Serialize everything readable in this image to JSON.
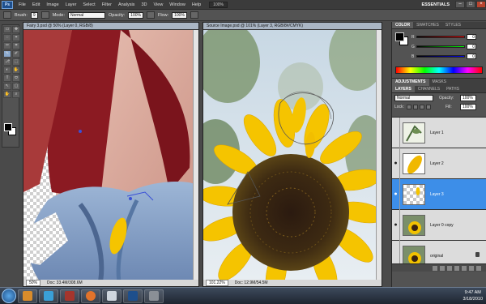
{
  "menubar": {
    "app": "Ps",
    "items": [
      "File",
      "Edit",
      "Image",
      "Layer",
      "Select",
      "Filter",
      "Analysis",
      "3D",
      "View",
      "Window",
      "Help"
    ],
    "zoom": "100%",
    "workspace": "ESSENTIALS",
    "win_min": "–",
    "win_max": "□",
    "win_close": "×"
  },
  "options": {
    "brush_label": "Brush:",
    "brush_size": "9",
    "mode_label": "Mode:",
    "mode_value": "Normal",
    "opacity_label": "Opacity:",
    "opacity_value": "100%",
    "flow_label": "Flow:",
    "flow_value": "100%"
  },
  "tools": [
    "▭",
    "✥",
    "◌",
    "⌖",
    "✂",
    "⌗",
    "✎",
    "✐",
    "⎇",
    "⬚",
    "◐",
    "✋",
    "T",
    "⬭",
    "↖",
    "▢",
    "✋",
    "⌕"
  ],
  "documents": {
    "left": {
      "tab": "Fairy 3.psd @ 50% (Layer 0, RGB/8)",
      "zoom": "50%",
      "doc": "Doc: 33.4M/308.6M"
    },
    "right": {
      "tab": "Source Image.psd @ 101% (Layer 3, RGB/8#/CMYK)",
      "zoom": "101.22%",
      "doc": "Doc: 12.9M/54.5M"
    }
  },
  "color_panel": {
    "tabs": [
      "COLOR",
      "SWATCHES",
      "STYLES"
    ],
    "r_label": "R",
    "g_label": "G",
    "b_label": "B",
    "r": "0",
    "g": "0",
    "b": "0"
  },
  "adjust_tabs": [
    "ADJUSTMENTS",
    "MASKS"
  ],
  "layers_panel": {
    "tabs": [
      "LAYERS",
      "CHANNELS",
      "PATHS"
    ],
    "blend_mode": "Normal",
    "opacity_label": "Opacity:",
    "opacity": "100%",
    "lock_label": "Lock:",
    "fill_label": "Fill:",
    "fill": "100%",
    "layers": [
      {
        "name": "Layer 1",
        "visible": false,
        "selected": false
      },
      {
        "name": "Layer 2",
        "visible": true,
        "selected": false
      },
      {
        "name": "Layer 3",
        "visible": true,
        "selected": true
      },
      {
        "name": "Layer 0 copy",
        "visible": true,
        "selected": false
      },
      {
        "name": "original",
        "visible": false,
        "selected": false,
        "locked": true
      }
    ]
  },
  "taskbar": {
    "time": "9:47 AM",
    "date": "3/18/2010"
  },
  "colors": {
    "selection": "#3d8ee8",
    "petal": "#f5c400",
    "hair": "#8b1a22",
    "dress": "#7d9dc6"
  }
}
